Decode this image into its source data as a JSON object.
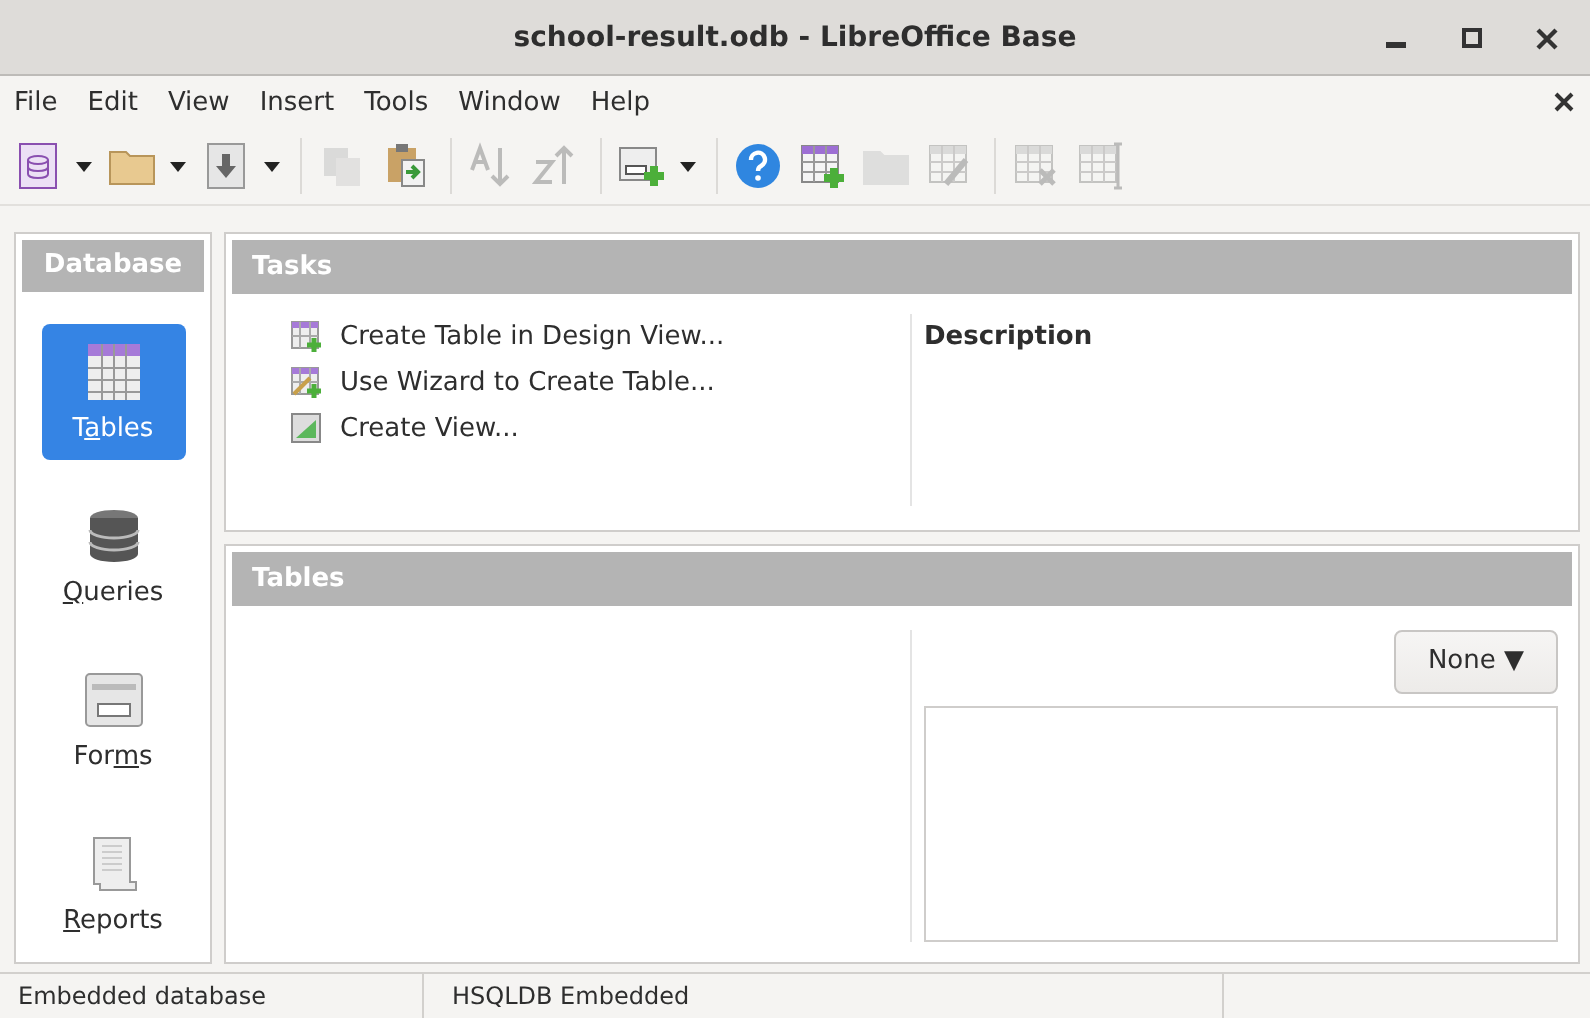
{
  "window": {
    "title": "school-result.odb - LibreOffice Base"
  },
  "menu": [
    "File",
    "Edit",
    "View",
    "Insert",
    "Tools",
    "Window",
    "Help"
  ],
  "toolbar": [
    {
      "kind": "database",
      "disabled": false,
      "dropdown": true
    },
    {
      "kind": "folder",
      "disabled": false,
      "dropdown": true
    },
    {
      "kind": "save",
      "disabled": false,
      "dropdown": true
    },
    {
      "kind": "separator"
    },
    {
      "kind": "copy",
      "disabled": true,
      "dropdown": false
    },
    {
      "kind": "paste",
      "disabled": false,
      "dropdown": false
    },
    {
      "kind": "separator"
    },
    {
      "kind": "sortasc",
      "disabled": true,
      "dropdown": false
    },
    {
      "kind": "sortdesc",
      "disabled": true,
      "dropdown": false
    },
    {
      "kind": "separator"
    },
    {
      "kind": "newform",
      "disabled": false,
      "dropdown": true
    },
    {
      "kind": "separator"
    },
    {
      "kind": "help",
      "disabled": false,
      "dropdown": false
    },
    {
      "kind": "newtable",
      "disabled": false,
      "dropdown": false
    },
    {
      "kind": "folder",
      "disabled": true,
      "dropdown": false
    },
    {
      "kind": "edittable",
      "disabled": true,
      "dropdown": false
    },
    {
      "kind": "separator"
    },
    {
      "kind": "deletetable",
      "disabled": true,
      "dropdown": false
    },
    {
      "kind": "columns",
      "disabled": true,
      "dropdown": false
    }
  ],
  "sidebar": {
    "title": "Database",
    "items": [
      {
        "kind": "tables",
        "before": "T",
        "key": "a",
        "after": "bles",
        "selected": true
      },
      {
        "kind": "queries",
        "key": "Q",
        "after": "ueries",
        "selected": false
      },
      {
        "kind": "forms",
        "before": "For",
        "key": "m",
        "after": "s",
        "selected": false
      },
      {
        "kind": "reports",
        "key": "R",
        "after": "eports",
        "selected": false
      }
    ]
  },
  "tasks": {
    "title": "Tasks",
    "items": [
      {
        "kind": "design",
        "label": "Create Table in Design View..."
      },
      {
        "kind": "wizard",
        "label": "Use Wizard to Create Table..."
      },
      {
        "kind": "view",
        "label": "Create View..."
      }
    ],
    "description_title": "Description"
  },
  "tables": {
    "title": "Tables",
    "preview_button": "None ▼"
  },
  "status_bar": [
    "Embedded database",
    "HSQLDB Embedded"
  ]
}
